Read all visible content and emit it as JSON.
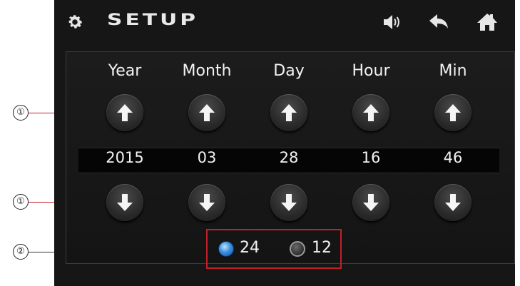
{
  "header": {
    "title": "SETUP",
    "icons": [
      "gear-icon",
      "sound-icon",
      "back-icon",
      "home-icon"
    ]
  },
  "columns": [
    {
      "label": "Year",
      "value": "2015"
    },
    {
      "label": "Month",
      "value": "03"
    },
    {
      "label": "Day",
      "value": "28"
    },
    {
      "label": "Hour",
      "value": "16"
    },
    {
      "label": "Min",
      "value": "46"
    }
  ],
  "time_format": {
    "options": [
      {
        "label": "24",
        "selected": true
      },
      {
        "label": "12",
        "selected": false
      }
    ]
  },
  "callouts": {
    "up": "①",
    "down": "①",
    "format": "②"
  },
  "colors": {
    "screen_bg": "#161616",
    "highlight_border": "#c0202a",
    "radio_selected": "#3b8fe0"
  }
}
